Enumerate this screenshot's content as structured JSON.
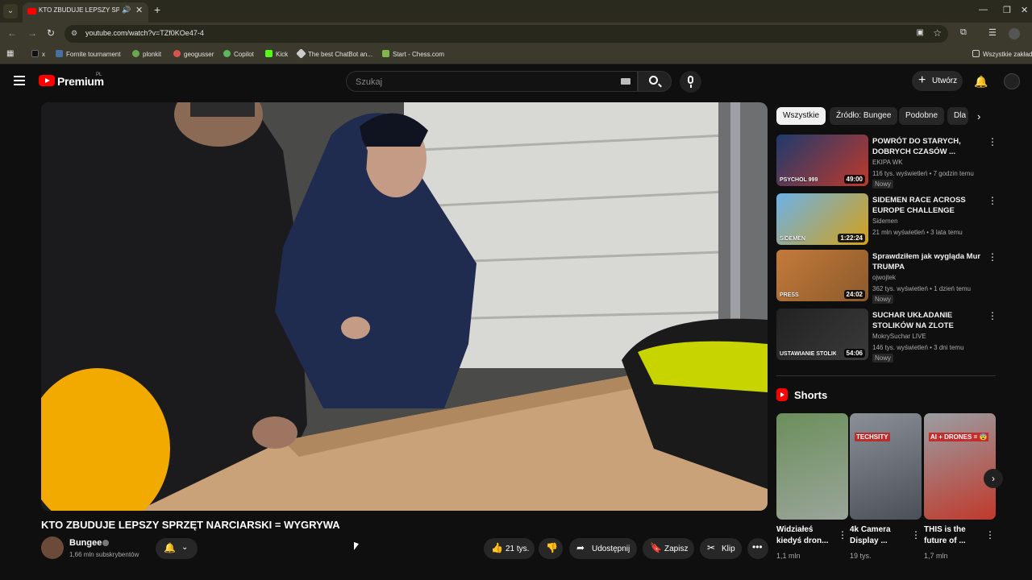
{
  "browser": {
    "tab_title": "KTO ZBUDUJE LEPSZY SPRZ",
    "url": "youtube.com/watch?v=TZf0KOe47-4",
    "bookmarks": [
      {
        "label": "x",
        "icon": "x-icon",
        "color": "#000000"
      },
      {
        "label": "Fornite tournament",
        "icon": "fortnite-icon",
        "color": "#4a6fa5"
      },
      {
        "label": "plonkit",
        "icon": "plonkit-icon",
        "color": "#6aa84f"
      },
      {
        "label": "geogusser",
        "icon": "geoguessr-icon",
        "color": "#d9534f"
      },
      {
        "label": "Copilot",
        "icon": "copilot-icon",
        "color": "#5cb85c"
      },
      {
        "label": "Kick",
        "icon": "kick-icon",
        "color": "#53fc18"
      },
      {
        "label": "The best ChatBot an...",
        "icon": "chatbot-icon",
        "color": "#cccccc"
      },
      {
        "label": "Start - Chess.com",
        "icon": "chess-icon",
        "color": "#81b64c"
      }
    ],
    "all_bookmarks": "Wszystkie zakład"
  },
  "header": {
    "logo_text": "Premium",
    "country": "PL",
    "search_placeholder": "Szukaj",
    "create_label": "Utwórz"
  },
  "video": {
    "title": "KTO ZBUDUJE LEPSZY SPRZĘT NARCIARSKI = WYGRYWA",
    "channel": "Bungee",
    "subscribers": "1,66 mln subskrybentów",
    "likes": "21 tys.",
    "share_label": "Udostępnij",
    "save_label": "Zapisz",
    "clip_label": "Klip"
  },
  "sidebar": {
    "chips": [
      "Wszystkie",
      "Źródło: Bungee",
      "Podobne",
      "Dla"
    ],
    "recommendations": [
      {
        "title": "POWRÓT DO STARYCH, DOBRYCH CZASÓW ...",
        "channel": "EKIPA WK",
        "meta": "116 tys. wyświetleń • 7 godzin temu",
        "badge": "Nowy",
        "duration": "49:00",
        "thumb_text": "PSYCHOL 999",
        "colors": [
          "#1e3a6e",
          "#c0392b"
        ]
      },
      {
        "title": "SIDEMEN RACE ACROSS EUROPE CHALLENGE",
        "channel": "Sidemen",
        "meta": "21 mln wyświetleń • 3 lata temu",
        "badge": "",
        "duration": "1:22:24",
        "thumb_text": "SIDEMEN",
        "colors": [
          "#6bb2e8",
          "#d4a017"
        ]
      },
      {
        "title": "Sprawdziłem jak wygląda Mur TRUMPA",
        "channel": "ojwojtek",
        "meta": "362 tys. wyświetleń • 1 dzień temu",
        "badge": "Nowy",
        "duration": "24:02",
        "thumb_text": "PRESS",
        "colors": [
          "#c47a3a",
          "#8b5a2b"
        ]
      },
      {
        "title": "SUCHAR UKŁADANIE STOLIKÓW NA ZLOTE ANTOSI...",
        "channel": "MokrySuchar LIVE",
        "meta": "146 tys. wyświetleń • 3 dni temu",
        "badge": "Nowy",
        "duration": "54:06",
        "thumb_text": "USTAWIANIE STOLIKÓW NA ZLOTE AN",
        "colors": [
          "#222222",
          "#3a3a3a"
        ]
      }
    ],
    "shorts_title": "Shorts",
    "shorts": [
      {
        "title": "Widziałeś kiedyś dron...",
        "views": "1,1 mln",
        "colors": [
          "#6b8f5a",
          "#9aa59a"
        ],
        "thumb_text": ""
      },
      {
        "title": "4k Camera Display ...",
        "views": "19 tys.",
        "colors": [
          "#8a8f98",
          "#4a4f58"
        ],
        "thumb_text": "TECHSITY"
      },
      {
        "title": "THIS is the future of ...",
        "views": "1,7 mln",
        "colors": [
          "#9a9ea4",
          "#c0392b"
        ],
        "thumb_text": "AI + DRONES = 😨"
      }
    ]
  }
}
